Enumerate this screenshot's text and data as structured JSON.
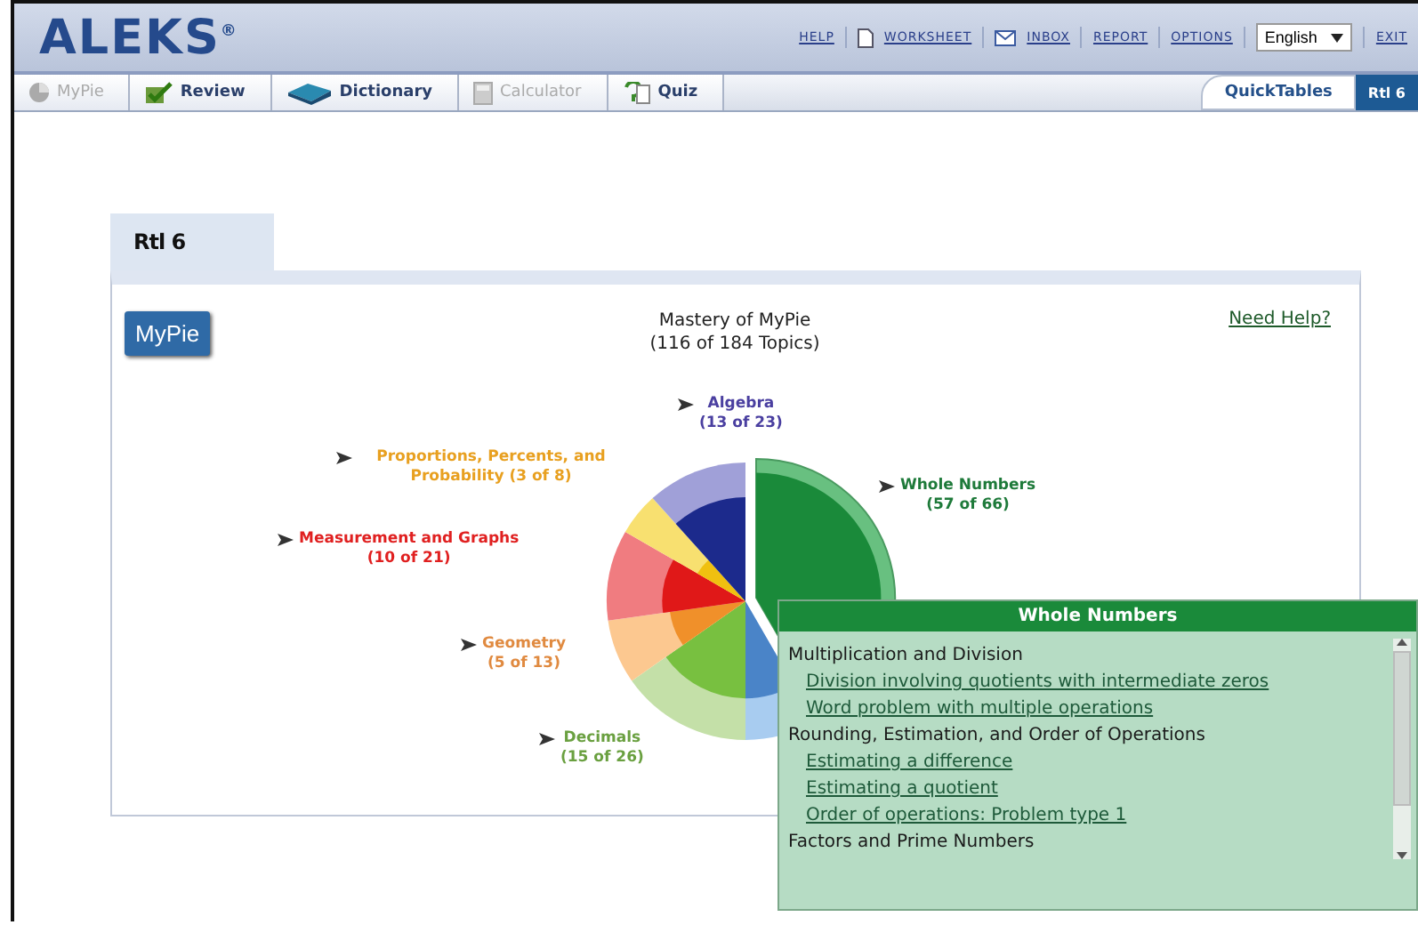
{
  "header": {
    "logo": "ALEKS$^{®}$",
    "links": [
      {
        "label": "HELP"
      },
      {
        "label": "WORKSHEET"
      },
      {
        "label": "INBOX"
      },
      {
        "label": "REPORT"
      },
      {
        "label": "OPTIONS"
      }
    ],
    "language": "English",
    "exit": "EXIT"
  },
  "nav_tabs": [
    {
      "label": "MyPie",
      "disabled": true
    },
    {
      "label": "Review",
      "disabled": false
    },
    {
      "label": "Dictionary",
      "disabled": false
    },
    {
      "label": "Calculator",
      "disabled": true
    },
    {
      "label": "Quiz",
      "disabled": false
    }
  ],
  "right_tabs": [
    {
      "label": "QuickTables",
      "selected": false
    },
    {
      "label": "Rtl 6",
      "selected": true
    }
  ],
  "panel": {
    "tab": "Rtl 6",
    "mypie_button": "MyPie",
    "title": "Mastery of MyPie",
    "subtitle": "(116 of 184 Topics)",
    "help_link": "Need Help?",
    "pie_labels": [
      {
        "name": "Algebra",
        "count": "(13 of 23)",
        "color": "#4a3fa0"
      },
      {
        "name": "Whole Numbers",
        "count": "(57 of 66)",
        "color": "#1e7a3a"
      },
      {
        "name": "Proportions, Percents, and Probability (3 of 8)",
        "color": "#e8a020"
      },
      {
        "name": "Measurement and Graphs",
        "count": "(10 of 21)",
        "color": "#e02020"
      },
      {
        "name": "Geometry",
        "count": "(5 of 13)",
        "color": "#e08a40"
      },
      {
        "name": "Decimals",
        "count": "(15 of 26)",
        "color": "#6aa040"
      }
    ]
  },
  "popup": {
    "title": "Whole Numbers",
    "groups": [
      {
        "heading": "Multiplication and Division",
        "items": [
          "Division involving quotients with intermediate zeros",
          "Word problem with multiple operations"
        ]
      },
      {
        "heading": "Rounding, Estimation, and Order of Operations",
        "items": [
          "Estimating a difference",
          "Estimating a quotient",
          "Order of operations: Problem type 1"
        ]
      },
      {
        "heading": "Factors and Prime Numbers"
      }
    ]
  }
}
